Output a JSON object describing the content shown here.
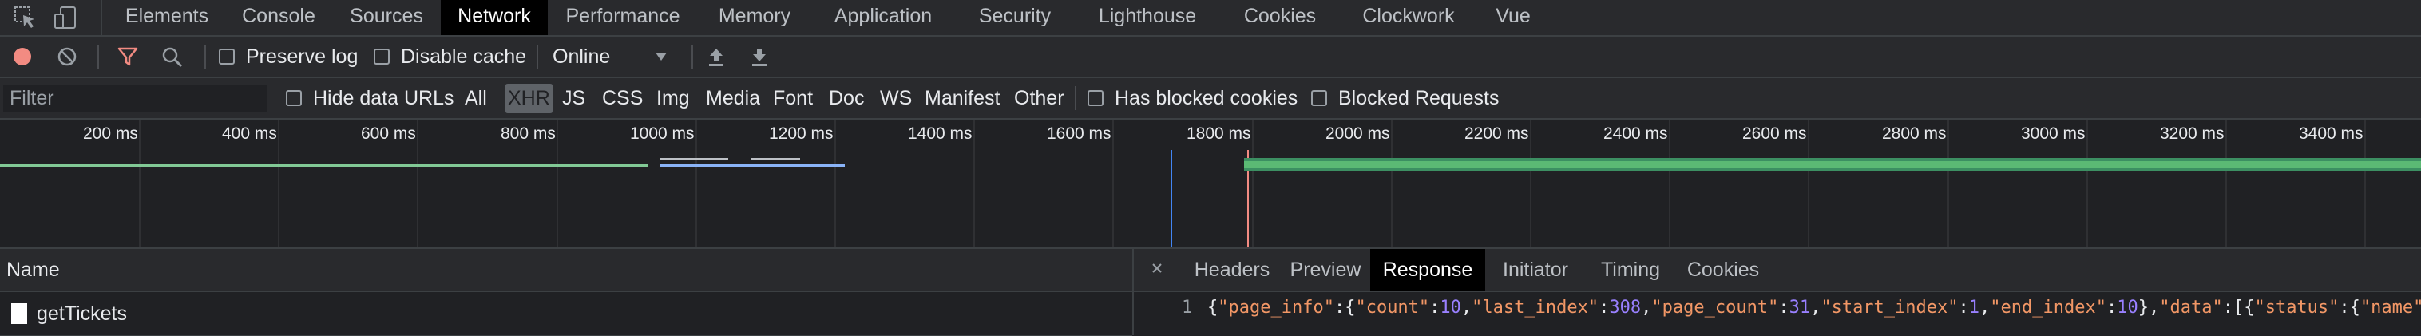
{
  "tabs": [
    {
      "label": "Elements"
    },
    {
      "label": "Console"
    },
    {
      "label": "Sources"
    },
    {
      "label": "Network"
    },
    {
      "label": "Performance"
    },
    {
      "label": "Memory"
    },
    {
      "label": "Application"
    },
    {
      "label": "Security"
    },
    {
      "label": "Lighthouse"
    },
    {
      "label": "Cookies"
    },
    {
      "label": "Clockwork"
    },
    {
      "label": "Vue"
    }
  ],
  "active_tab": "Network",
  "toolbar": {
    "preserve_log": "Preserve log",
    "disable_cache": "Disable cache",
    "throttling": "Online",
    "record_color": "#f28b82",
    "filter_icon_color": "#f28b82"
  },
  "filter_bar": {
    "placeholder": "Filter",
    "hide_data_urls": "Hide data URLs",
    "types": [
      "All",
      "XHR",
      "JS",
      "CSS",
      "Img",
      "Media",
      "Font",
      "Doc",
      "WS",
      "Manifest",
      "Other"
    ],
    "selected_type": "XHR",
    "has_blocked_cookies": "Has blocked cookies",
    "blocked_requests": "Blocked Requests"
  },
  "timeline": {
    "ticks": [
      "200 ms",
      "400 ms",
      "600 ms",
      "800 ms",
      "1000 ms",
      "1200 ms",
      "1400 ms",
      "1600 ms",
      "1800 ms",
      "2000 ms",
      "2200 ms",
      "2400 ms",
      "2600 ms",
      "2800 ms",
      "3000 ms",
      "3200 ms",
      "3400 ms"
    ]
  },
  "requests_header": "Name",
  "requests": [
    {
      "name": "getTickets"
    }
  ],
  "detail_tabs": [
    {
      "label": "Headers"
    },
    {
      "label": "Preview"
    },
    {
      "label": "Response"
    },
    {
      "label": "Initiator"
    },
    {
      "label": "Timing"
    },
    {
      "label": "Cookies"
    }
  ],
  "active_detail_tab": "Response",
  "response": {
    "line_number": "1",
    "tokens": [
      {
        "c": "p",
        "t": "{"
      },
      {
        "c": "k",
        "t": "\"page_info\""
      },
      {
        "c": "p",
        "t": ":{"
      },
      {
        "c": "k",
        "t": "\"count\""
      },
      {
        "c": "p",
        "t": ":"
      },
      {
        "c": "n",
        "t": "10"
      },
      {
        "c": "p",
        "t": ","
      },
      {
        "c": "k",
        "t": "\"last_index\""
      },
      {
        "c": "p",
        "t": ":"
      },
      {
        "c": "n",
        "t": "308"
      },
      {
        "c": "p",
        "t": ","
      },
      {
        "c": "k",
        "t": "\"page_count\""
      },
      {
        "c": "p",
        "t": ":"
      },
      {
        "c": "n",
        "t": "31"
      },
      {
        "c": "p",
        "t": ","
      },
      {
        "c": "k",
        "t": "\"start_index\""
      },
      {
        "c": "p",
        "t": ":"
      },
      {
        "c": "n",
        "t": "1"
      },
      {
        "c": "p",
        "t": ","
      },
      {
        "c": "k",
        "t": "\"end_index\""
      },
      {
        "c": "p",
        "t": ":"
      },
      {
        "c": "n",
        "t": "10"
      },
      {
        "c": "p",
        "t": "},"
      },
      {
        "c": "k",
        "t": "\"data\""
      },
      {
        "c": "p",
        "t": ":[{"
      },
      {
        "c": "k",
        "t": "\"status\""
      },
      {
        "c": "p",
        "t": ":{"
      },
      {
        "c": "k",
        "t": "\"name\""
      }
    ]
  }
}
